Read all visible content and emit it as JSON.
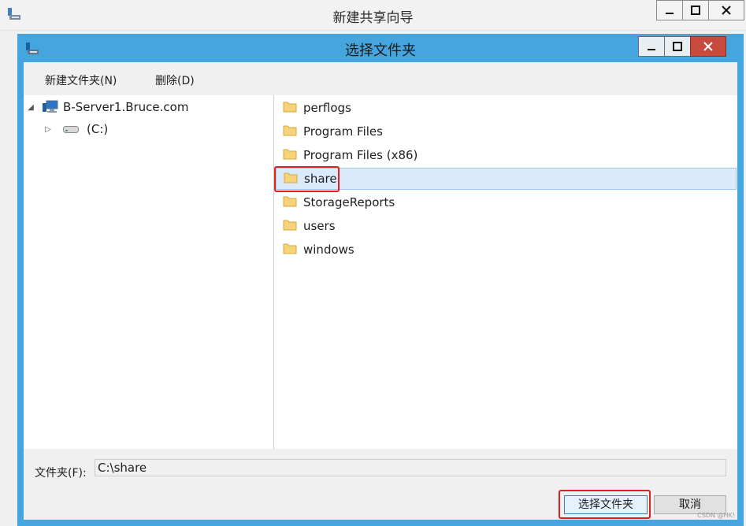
{
  "outer_window": {
    "title": "新建共享向导"
  },
  "dialog": {
    "title": "选择文件夹",
    "toolbar": {
      "new_folder": "新建文件夹(N)",
      "delete": "删除(D)"
    },
    "tree": {
      "root": "B-Server1.Bruce.com",
      "children": [
        {
          "label": "(C:)"
        }
      ]
    },
    "list": {
      "items": [
        {
          "label": "perflogs"
        },
        {
          "label": "Program Files"
        },
        {
          "label": "Program Files (x86)"
        },
        {
          "label": "share",
          "selected": true
        },
        {
          "label": "StorageReports"
        },
        {
          "label": "users"
        },
        {
          "label": "windows"
        }
      ]
    },
    "folder_label": "文件夹(F):",
    "folder_value": "C:\\share",
    "buttons": {
      "select": "选择文件夹",
      "cancel": "取消"
    }
  },
  "watermark": "CSDN @HK!",
  "colors": {
    "dialog_frame": "#45a6df",
    "close_button": "#c74a3d",
    "highlight": "#e0201f",
    "selection": "#dbeafb"
  }
}
